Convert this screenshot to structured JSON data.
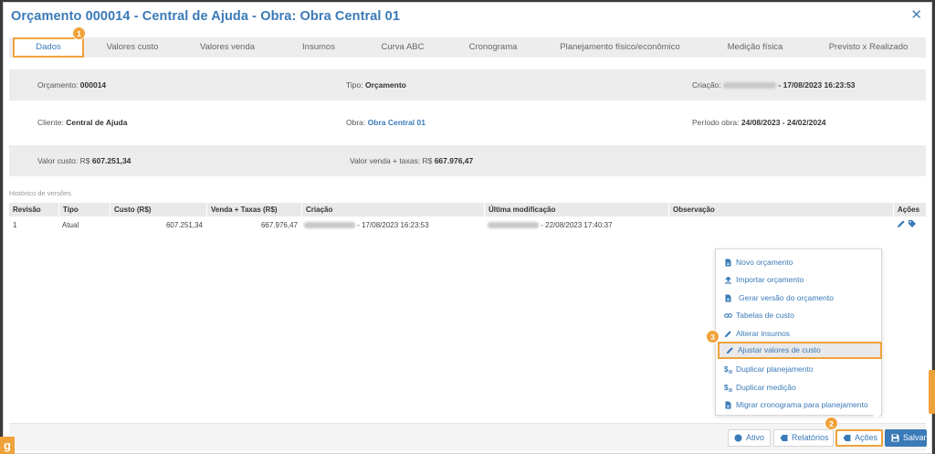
{
  "title": "Orçamento 000014 - Central de Ajuda - Obra: Obra Central 01",
  "close_glyph": "✕",
  "tabs": [
    {
      "label": "Dados"
    },
    {
      "label": "Valores custo"
    },
    {
      "label": "Valores venda"
    },
    {
      "label": "Insumos"
    },
    {
      "label": "Curva ABC"
    },
    {
      "label": "Cronograma"
    },
    {
      "label": "Planejamento físico/econômico"
    },
    {
      "label": "Medição física"
    },
    {
      "label": "Previsto x Realizado"
    }
  ],
  "info": {
    "orcamento_label": "Orçamento:",
    "orcamento_value": "000014",
    "tipo_label": "Tipo:",
    "tipo_value": "Orçamento",
    "criacao_label": "Criação:",
    "criacao_value": "- 17/08/2023 16:23:53",
    "cliente_label": "Cliente:",
    "cliente_value": "Central de Ajuda",
    "obra_label": "Obra:",
    "obra_value": "Obra Central 01",
    "periodo_label": "Período obra:",
    "periodo_value": "24/08/2023 - 24/02/2024",
    "valor_custo_label": "Valor custo: R$",
    "valor_custo_value": "607.251,34",
    "valor_venda_label": "Valor venda + taxas: R$",
    "valor_venda_value": "667.976,47"
  },
  "history": {
    "label": "Histórico de versões",
    "columns": [
      "Revisão",
      "Tipo",
      "Custo (R$)",
      "Venda + Taxas (R$)",
      "Criação",
      "Última modificação",
      "Observação",
      "Ações"
    ],
    "row": {
      "revisao": "1",
      "tipo": "Atual",
      "custo": "607.251,34",
      "venda": "667.976,47",
      "criacao": "- 17/08/2023 16:23:53",
      "ultima": "- 22/08/2023 17:40:37",
      "observacao": ""
    }
  },
  "actions_menu": [
    {
      "label": "Novo orçamento",
      "icon": "document-icon"
    },
    {
      "label": "Importar orçamento",
      "icon": "upload-icon"
    },
    {
      "label": "Gerar versão do orçamento",
      "icon": "document-icon"
    },
    {
      "label": "Tabelas de custo",
      "icon": "link-icon"
    },
    {
      "label": "Alterar insumos",
      "icon": "pencil-icon"
    },
    {
      "label": "Ajustar valores de custo",
      "icon": "pencil-icon"
    },
    {
      "label": "Duplicar planejamento",
      "icon": "dollar-list-icon"
    },
    {
      "label": "Duplicar medição",
      "icon": "dollar-list-icon"
    },
    {
      "label": "Migrar cronograma para planejamento",
      "icon": "document-icon"
    }
  ],
  "footer": {
    "ativo": "Ativo",
    "relatorios": "Relatórios",
    "acoes": "Ações",
    "salvar": "Salvar"
  },
  "badges": {
    "b1": "1",
    "b2": "2",
    "b3": "3",
    "corner": "g"
  },
  "colors": {
    "accent": "#3a7ab8",
    "highlight": "#f0a23a",
    "band": "#ececec"
  }
}
